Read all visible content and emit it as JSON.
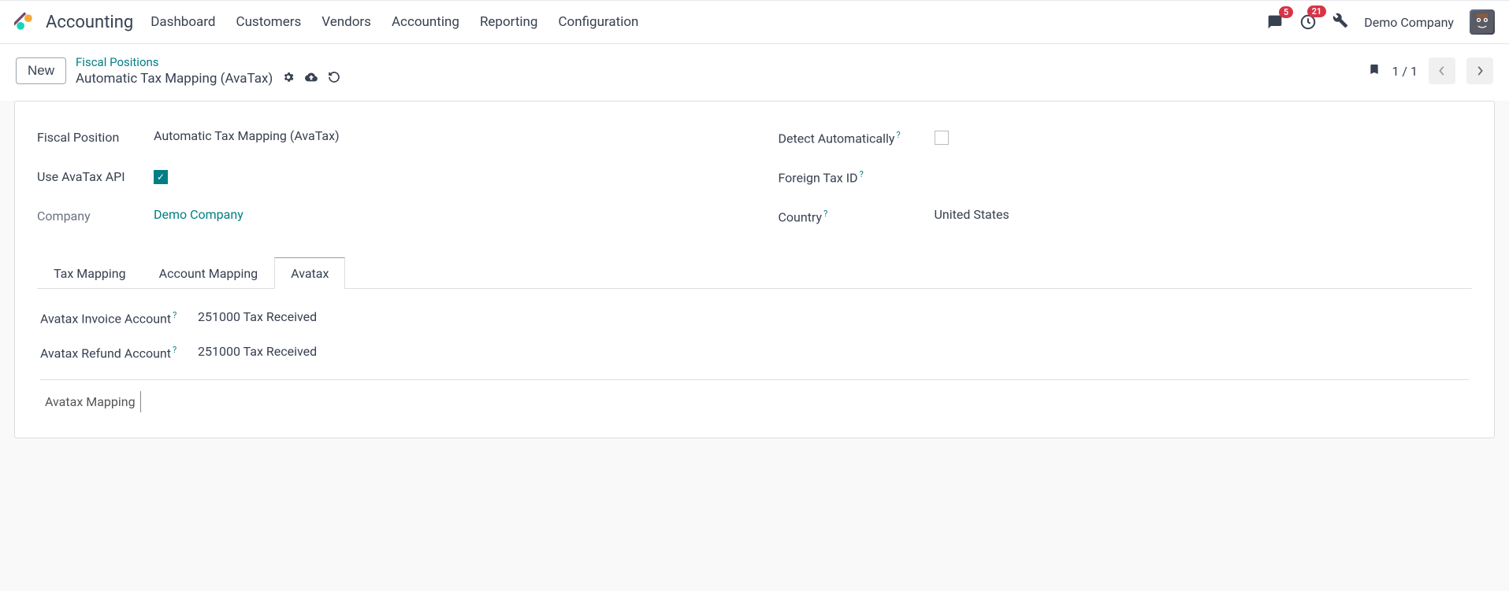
{
  "header": {
    "app_title": "Accounting",
    "nav": [
      "Dashboard",
      "Customers",
      "Vendors",
      "Accounting",
      "Reporting",
      "Configuration"
    ],
    "messages_badge": "5",
    "activities_badge": "21",
    "company": "Demo Company"
  },
  "control": {
    "new_label": "New",
    "breadcrumb_parent": "Fiscal Positions",
    "record_title": "Automatic Tax Mapping (AvaTax)",
    "pager": "1 / 1"
  },
  "form": {
    "fiscal_position_label": "Fiscal Position",
    "fiscal_position_value": "Automatic Tax Mapping (AvaTax)",
    "use_avatax_label": "Use AvaTax API",
    "company_label": "Company",
    "company_value": "Demo Company",
    "detect_auto_label": "Detect Automatically",
    "foreign_tax_label": "Foreign Tax ID",
    "foreign_tax_value": "",
    "country_label": "Country",
    "country_value": "United States"
  },
  "tabs": {
    "tax_mapping": "Tax Mapping",
    "account_mapping": "Account Mapping",
    "avatax": "Avatax"
  },
  "avatax_tab": {
    "invoice_account_label": "Avatax Invoice Account",
    "invoice_account_value": "251000 Tax Received",
    "refund_account_label": "Avatax Refund Account",
    "refund_account_value": "251000 Tax Received",
    "section_title": "Avatax Mapping"
  }
}
